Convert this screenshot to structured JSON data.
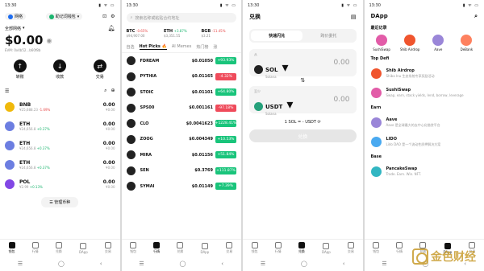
{
  "status_time": "13:30",
  "status_icons": "▮ ᯤ ▭",
  "nav": {
    "tabs": [
      "钱包",
      "行情",
      "兑换",
      "DApp",
      "交易"
    ],
    "sys": [
      "☰",
      "◯",
      "‹"
    ]
  },
  "wallet": {
    "network_chip": "网络",
    "wallet_chip": "助记词钱包",
    "account_label": "全部网络",
    "balance": "$0.00",
    "address": "EVM: 0x4b52...b60f8b",
    "actions": [
      "转账",
      "收款",
      "交易"
    ],
    "assets": [
      {
        "sym": "BNB",
        "sub": "¥25,688.23",
        "chg": "-1.69%",
        "neg": true,
        "a": "0.00",
        "b": "¥0.00",
        "color": "#f0b90b"
      },
      {
        "sym": "ETH",
        "sub": "¥24,656.8",
        "chg": "+0.37%",
        "neg": false,
        "a": "0.00",
        "b": "¥0.00",
        "color": "#6c7ee1"
      },
      {
        "sym": "ETH",
        "sub": "¥24,656.8",
        "chg": "+0.37%",
        "neg": false,
        "a": "0.00",
        "b": "¥0.00",
        "color": "#6c7ee1"
      },
      {
        "sym": "ETH",
        "sub": "¥24,656.8",
        "chg": "+0.37%",
        "neg": false,
        "a": "0.00",
        "b": "¥0.00",
        "color": "#6c7ee1"
      },
      {
        "sym": "POL",
        "sub": "¥2.99",
        "chg": "+0.13%",
        "neg": false,
        "a": "0.00",
        "b": "¥0.00",
        "color": "#8247e5"
      }
    ],
    "manage_label": "管理币种"
  },
  "market": {
    "search_placeholder": "搜索名称或粘贴合约地址",
    "tickers": [
      {
        "n": "BTC",
        "c": "-0.65%",
        "p": "$94,907.00",
        "neg": true
      },
      {
        "n": "ETH",
        "c": "+3.87%",
        "p": "$3,351.55",
        "neg": false
      },
      {
        "n": "BGB",
        "c": "-11.45%",
        "p": "$3.21",
        "neg": true
      }
    ],
    "tabs": [
      "自选",
      "Hot Picks 🔥",
      "AI Memes",
      "热门榜",
      "涨"
    ],
    "rows": [
      {
        "name": "FDREAM",
        "price": "$0.01050",
        "chg": "+93.93%",
        "up": true
      },
      {
        "name": "PYTHIA",
        "price": "$0.01165",
        "chg": "-4.32%",
        "up": false
      },
      {
        "name": "STOIC",
        "price": "$0.01101",
        "chg": "+64.80%",
        "up": true
      },
      {
        "name": "SPS00",
        "price": "$0.001161",
        "chg": "-97.18%",
        "up": false
      },
      {
        "name": "CLO",
        "price": "$0.0041623",
        "chg": "+1228.41%",
        "up": true
      },
      {
        "name": "ZOOG",
        "price": "$0.004349",
        "chg": "+10.53%",
        "up": true
      },
      {
        "name": "MIRA",
        "price": "$0.01156",
        "chg": "+51.84%",
        "up": true
      },
      {
        "name": "SEN",
        "price": "$0.3769",
        "chg": "+111.87%",
        "up": true
      },
      {
        "name": "SYMAI",
        "price": "$0.01149",
        "chg": "+7.39%",
        "up": true
      }
    ]
  },
  "swap": {
    "title": "兑换",
    "seg": [
      "快速闪兑",
      "跨价委托"
    ],
    "from_label": "从",
    "from_token": "SOL",
    "from_net": "Solana",
    "from_amt": "0.00",
    "to_label": "至少",
    "to_token": "USDT",
    "to_net": "Solana",
    "to_amt": "0.00",
    "rate": "1 SOL = - USDT",
    "button": "兑换"
  },
  "dapp": {
    "title": "DApp",
    "recent_title": "最近记录",
    "recent": [
      {
        "name": "SushiSwap",
        "color": "#e25ca8"
      },
      {
        "name": "Shib Airdrop",
        "color": "#f0552e"
      },
      {
        "name": "Aave",
        "color": "#9a86d8"
      },
      {
        "name": "DeBank",
        "color": "#fe815f"
      }
    ],
    "sections": [
      {
        "title": "Top Defi",
        "items": [
          {
            "t": "Shib Airdrop",
            "d": "Shiba Inu 生态系统专享奖励活动",
            "color": "#f0552e"
          },
          {
            "t": "SushiSwap",
            "d": "Swap, earn, stack yields, lend, borrow, leverage",
            "color": "#e25ca8"
          }
        ]
      },
      {
        "title": "Earn",
        "items": [
          {
            "t": "Aave",
            "d": "Aave 是全球最大的去中心化借贷平台",
            "color": "#9a86d8"
          },
          {
            "t": "LIDO",
            "d": "Lido DAO 是一个流动性质押解决方案",
            "color": "#49a9f0"
          }
        ]
      },
      {
        "title": "Base",
        "items": [
          {
            "t": "PancakeSwap",
            "d": "Trade. Earn. Win. NFT.",
            "color": "#32b6c2"
          }
        ]
      }
    ]
  },
  "watermark": "金色财经"
}
